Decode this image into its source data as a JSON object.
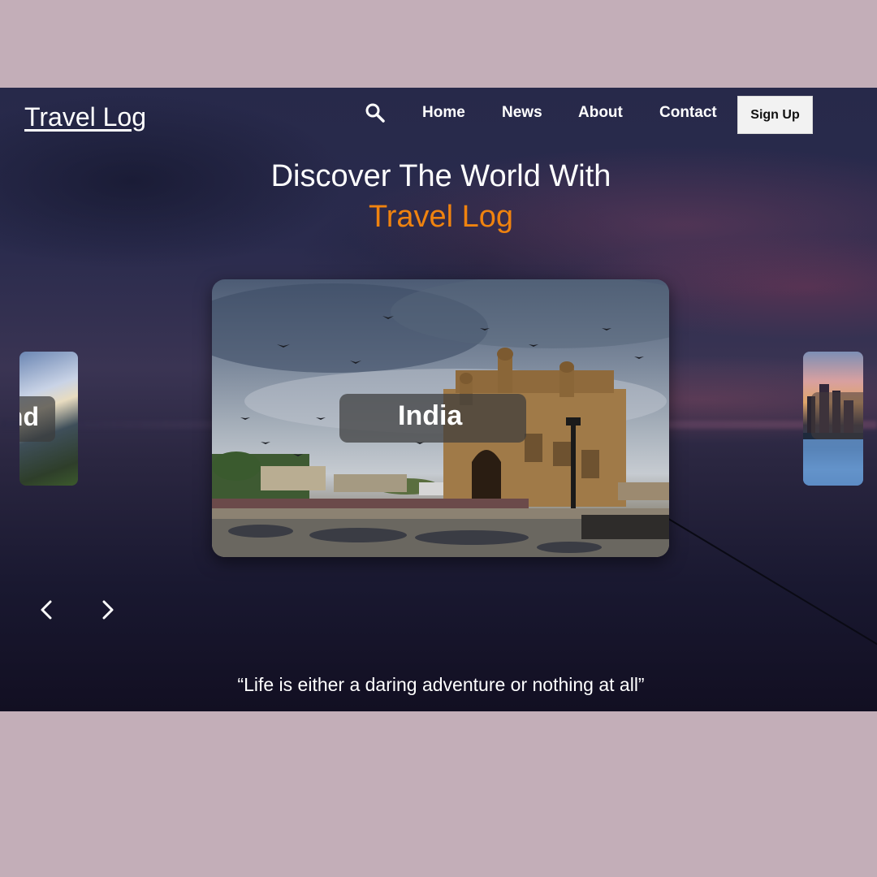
{
  "brand": {
    "logo": "Travel Log"
  },
  "nav": {
    "search_icon": "search-icon",
    "items": [
      "Home",
      "News",
      "About",
      "Contact"
    ],
    "signup_label": "Sign Up"
  },
  "hero": {
    "headline_line1": "Discover The World With",
    "headline_line2": "Travel Log",
    "accent_color": "#f0830f"
  },
  "carousel": {
    "active": {
      "label": "India"
    },
    "prev": {
      "label": "nd"
    },
    "next": {
      "label": ""
    },
    "prev_icon": "chevron-left-icon",
    "next_icon": "chevron-right-icon"
  },
  "quote": "“Life is either a daring adventure or nothing at all”"
}
